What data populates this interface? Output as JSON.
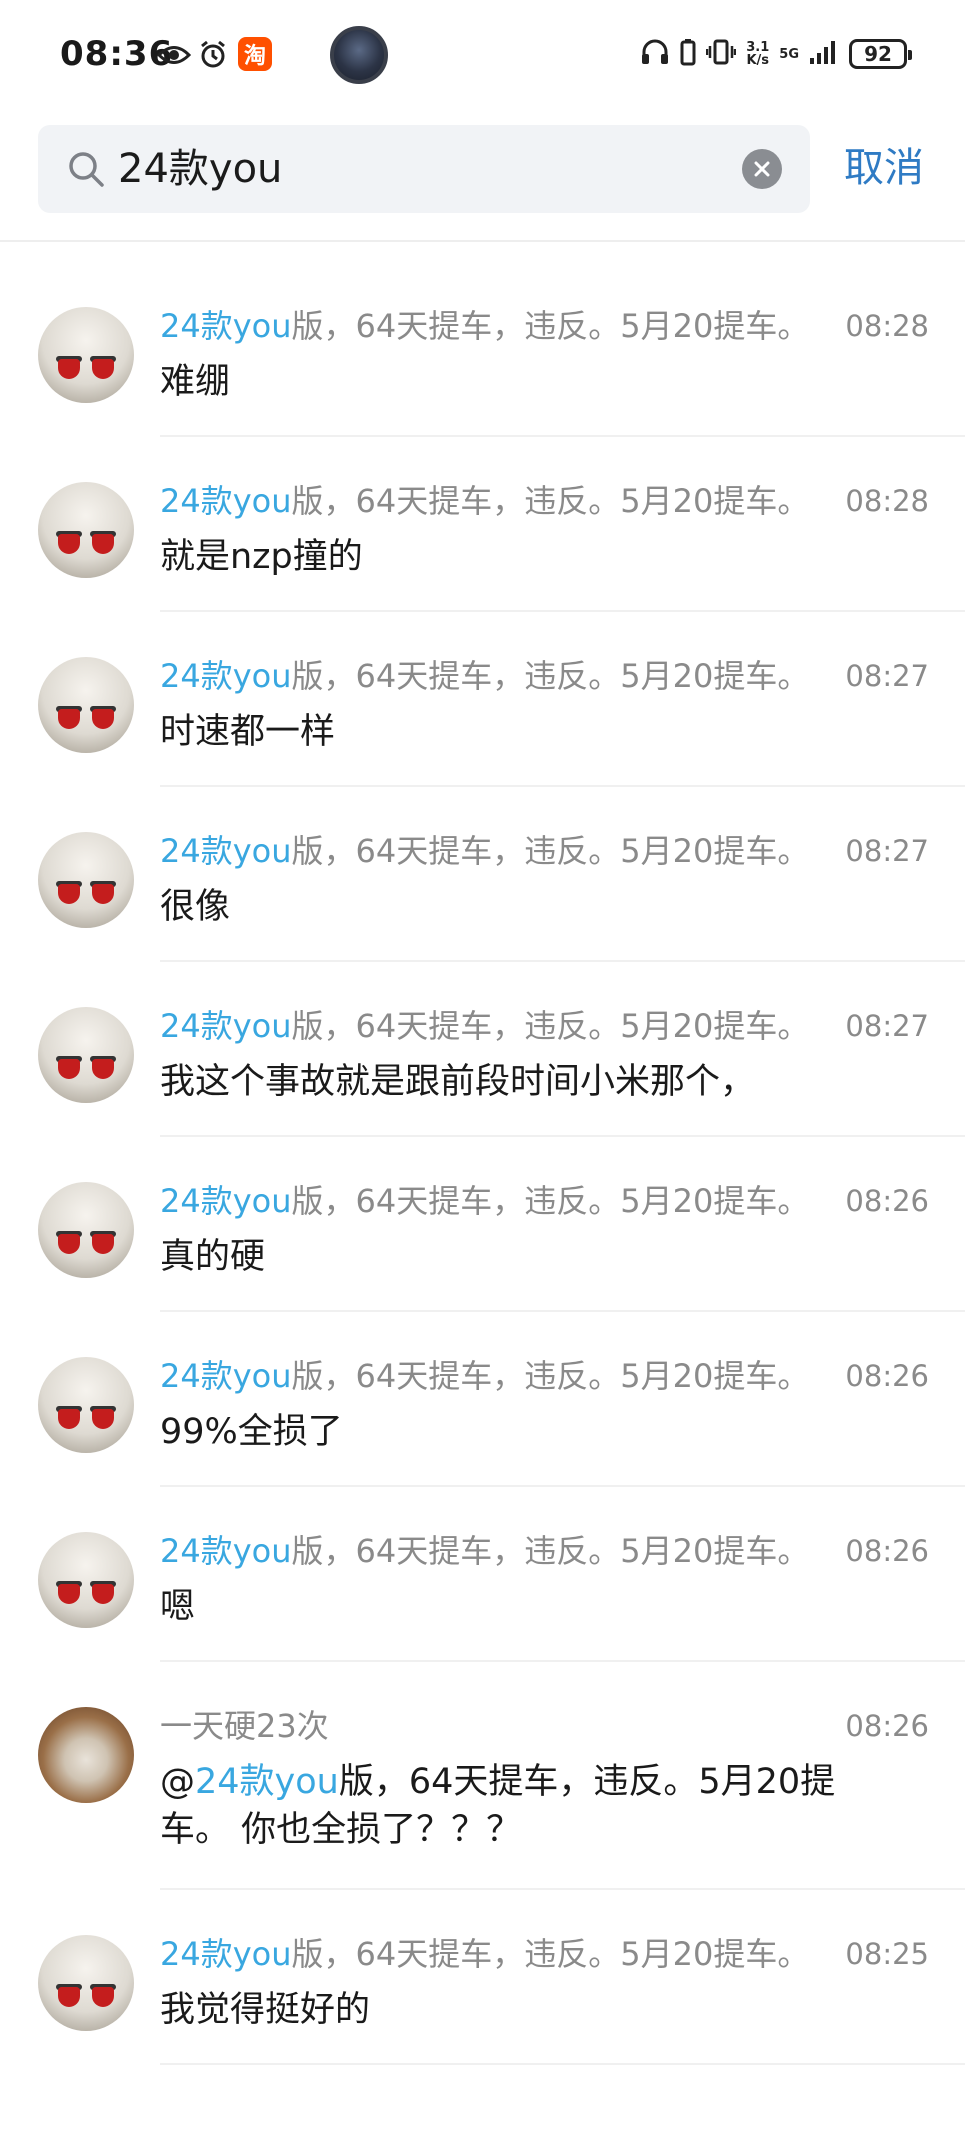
{
  "status_bar": {
    "time": "08:36",
    "taobao_glyph": "淘",
    "net_speed": "3.1",
    "net_unit": "K/s",
    "network": "5G",
    "battery": "92",
    "icons": [
      "eye-icon",
      "alarm-icon",
      "taobao-app-icon",
      "headphones-icon",
      "battery-saver-icon",
      "vibrate-icon",
      "signal-icon",
      "battery-icon"
    ]
  },
  "search": {
    "query": "24款you",
    "cancel_label": "取消"
  },
  "colors": {
    "highlight": "#39a7e0",
    "cancel": "#2f7bc4",
    "meta_gray": "#8a8a8a"
  },
  "messages": [
    {
      "sender_hl": "24款you",
      "sender_rest": "版，64天提车，违反。5月20提车。",
      "time": "08:28",
      "text": "难绷"
    },
    {
      "sender_hl": "24款you",
      "sender_rest": "版，64天提车，违反。5月20提车。",
      "time": "08:28",
      "text": "就是nzp撞的"
    },
    {
      "sender_hl": "24款you",
      "sender_rest": "版，64天提车，违反。5月20提车。",
      "time": "08:27",
      "text": "时速都一样"
    },
    {
      "sender_hl": "24款you",
      "sender_rest": "版，64天提车，违反。5月20提车。",
      "time": "08:27",
      "text": "很像"
    },
    {
      "sender_hl": "24款you",
      "sender_rest": "版，64天提车，违反。5月20提车。",
      "time": "08:27",
      "text": "我这个事故就是跟前段时间小米那个，"
    },
    {
      "sender_hl": "24款you",
      "sender_rest": "版，64天提车，违反。5月20提车。",
      "time": "08:26",
      "text": "真的硬"
    },
    {
      "sender_hl": "24款you",
      "sender_rest": "版，64天提车，违反。5月20提车。",
      "time": "08:26",
      "text": "99%全损了"
    },
    {
      "sender_hl": "24款you",
      "sender_rest": "版，64天提车，违反。5月20提车。",
      "time": "08:26",
      "text": "嗯"
    },
    {
      "sender": "一天硬23次",
      "time": "08:26",
      "reply_at": "@",
      "reply_hl": "24款you",
      "reply_rest": "版，64天提车，违反。5月20提车。 你也全损了？？？"
    },
    {
      "sender_hl": "24款you",
      "sender_rest": "版，64天提车，违反。5月20提车。",
      "time": "08:25",
      "text": "我觉得挺好的"
    }
  ]
}
